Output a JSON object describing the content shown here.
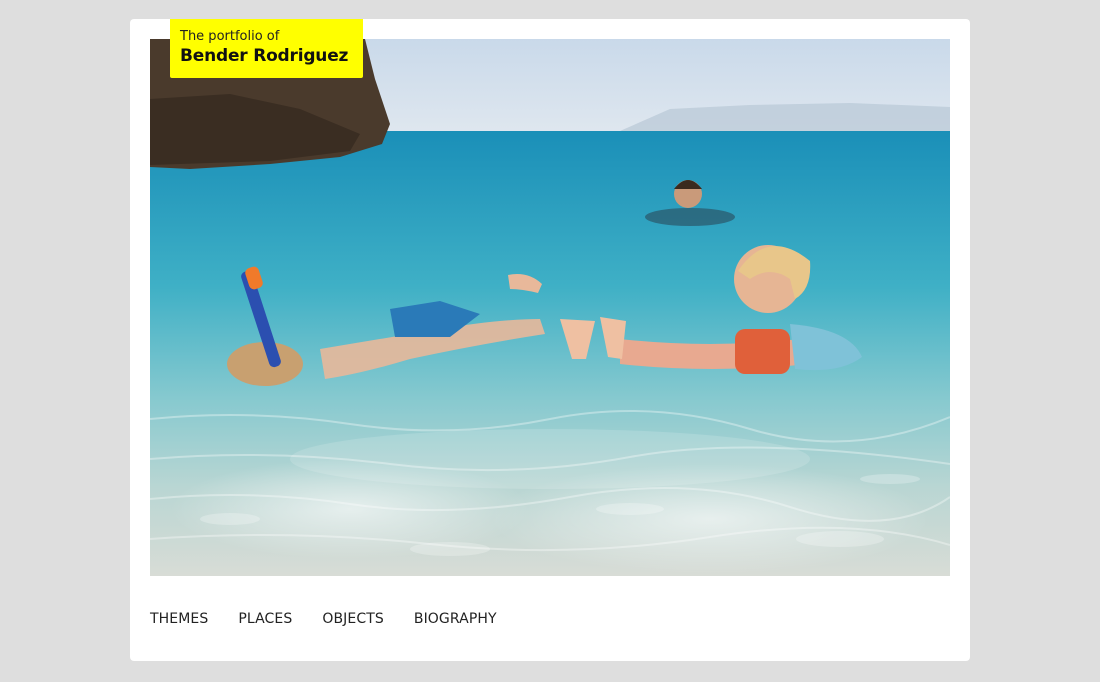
{
  "brand": {
    "kicker": "The portfolio of",
    "name": "Bender Rodriguez",
    "color": "#ffff00"
  },
  "photo": {
    "subject": "beach-swimming-photo"
  },
  "nav": {
    "items": [
      {
        "label": "THEMES"
      },
      {
        "label": "PLACES"
      },
      {
        "label": "OBJECTS"
      },
      {
        "label": "BIOGRAPHY"
      }
    ]
  },
  "colors": {
    "page_background": "#dedede",
    "card_background": "#ffffff",
    "nav_text": "#222222"
  }
}
